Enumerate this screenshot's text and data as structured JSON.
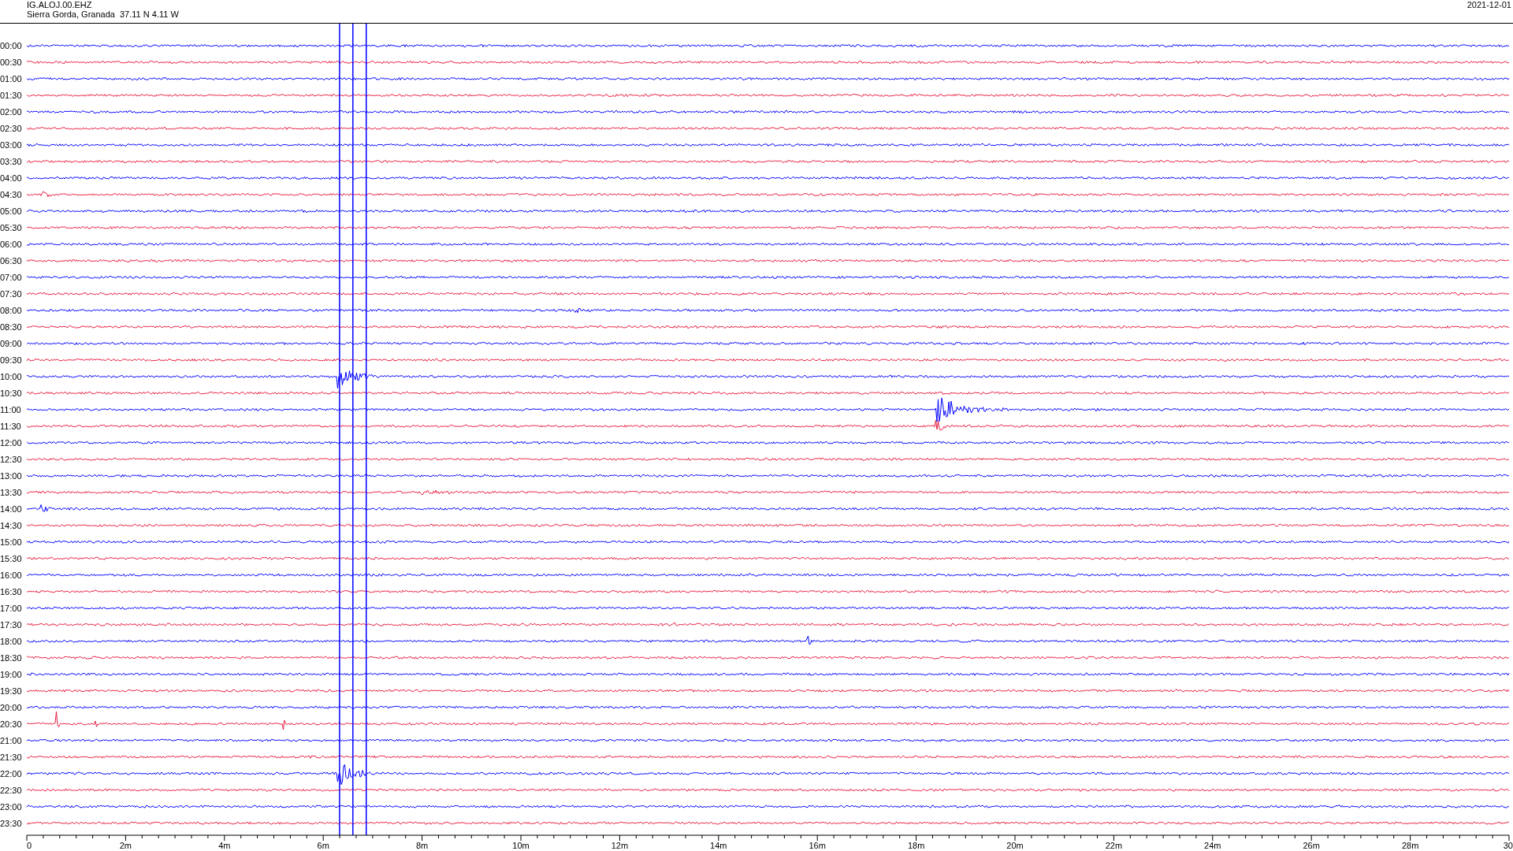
{
  "header": {
    "station_code": "IG.ALOJ.00.EHZ",
    "location": "Sierra Gorda, Granada  37.11 N 4.11 W",
    "date": "2021-12-01"
  },
  "rows": [
    {
      "label": "00:00",
      "color": "#0000ff"
    },
    {
      "label": "00:30",
      "color": "#e8193c"
    },
    {
      "label": "01:00",
      "color": "#0000ff"
    },
    {
      "label": "01:30",
      "color": "#e8193c"
    },
    {
      "label": "02:00",
      "color": "#0000ff"
    },
    {
      "label": "02:30",
      "color": "#e8193c"
    },
    {
      "label": "03:00",
      "color": "#0000ff"
    },
    {
      "label": "03:30",
      "color": "#e8193c"
    },
    {
      "label": "04:00",
      "color": "#0000ff"
    },
    {
      "label": "04:30",
      "color": "#e8193c"
    },
    {
      "label": "05:00",
      "color": "#0000ff"
    },
    {
      "label": "05:30",
      "color": "#e8193c"
    },
    {
      "label": "06:00",
      "color": "#0000ff"
    },
    {
      "label": "06:30",
      "color": "#e8193c"
    },
    {
      "label": "07:00",
      "color": "#0000ff"
    },
    {
      "label": "07:30",
      "color": "#e8193c"
    },
    {
      "label": "08:00",
      "color": "#0000ff"
    },
    {
      "label": "08:30",
      "color": "#e8193c"
    },
    {
      "label": "09:00",
      "color": "#0000ff"
    },
    {
      "label": "09:30",
      "color": "#e8193c"
    },
    {
      "label": "10:00",
      "color": "#0000ff"
    },
    {
      "label": "10:30",
      "color": "#e8193c"
    },
    {
      "label": "11:00",
      "color": "#0000ff"
    },
    {
      "label": "11:30",
      "color": "#e8193c"
    },
    {
      "label": "12:00",
      "color": "#0000ff"
    },
    {
      "label": "12:30",
      "color": "#e8193c"
    },
    {
      "label": "13:00",
      "color": "#0000ff"
    },
    {
      "label": "13:30",
      "color": "#e8193c"
    },
    {
      "label": "14:00",
      "color": "#0000ff"
    },
    {
      "label": "14:30",
      "color": "#e8193c"
    },
    {
      "label": "15:00",
      "color": "#0000ff"
    },
    {
      "label": "15:30",
      "color": "#e8193c"
    },
    {
      "label": "16:00",
      "color": "#0000ff"
    },
    {
      "label": "16:30",
      "color": "#e8193c"
    },
    {
      "label": "17:00",
      "color": "#0000ff"
    },
    {
      "label": "17:30",
      "color": "#e8193c"
    },
    {
      "label": "18:00",
      "color": "#0000ff"
    },
    {
      "label": "18:30",
      "color": "#e8193c"
    },
    {
      "label": "19:00",
      "color": "#0000ff"
    },
    {
      "label": "19:30",
      "color": "#e8193c"
    },
    {
      "label": "20:00",
      "color": "#0000ff"
    },
    {
      "label": "20:30",
      "color": "#e8193c"
    },
    {
      "label": "21:00",
      "color": "#0000ff"
    },
    {
      "label": "21:30",
      "color": "#e8193c"
    },
    {
      "label": "22:00",
      "color": "#0000ff"
    },
    {
      "label": "22:30",
      "color": "#e8193c"
    },
    {
      "label": "23:00",
      "color": "#0000ff"
    },
    {
      "label": "23:30",
      "color": "#e8193c"
    }
  ],
  "x_axis": {
    "labels": [
      "0",
      "2m",
      "4m",
      "6m",
      "8m",
      "10m",
      "12m",
      "14m",
      "16m",
      "18m",
      "20m",
      "22m",
      "24m",
      "26m",
      "28m",
      "30"
    ]
  }
}
